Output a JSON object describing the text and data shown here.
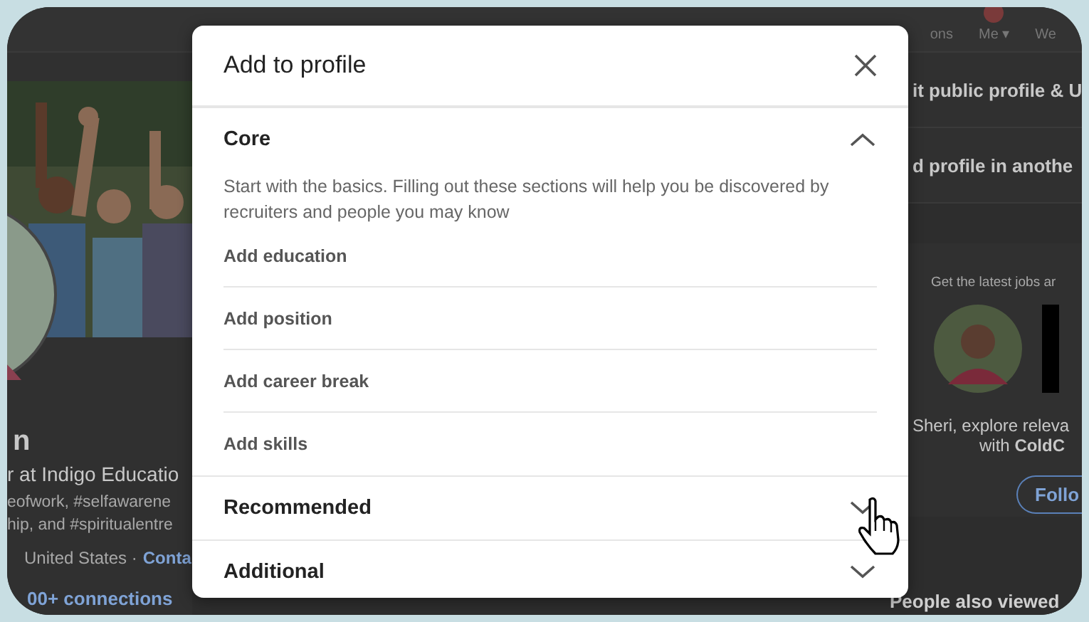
{
  "nav_items": [
    {
      "label": "ons"
    },
    {
      "label": "Me ▾"
    },
    {
      "label": "We"
    }
  ],
  "profile": {
    "name": "n",
    "headline": "r at Indigo Educatio",
    "hashtags": [
      "eofwork, #selfawarene",
      "hip, and #spiritualentre"
    ],
    "location": "United States ·",
    "contact_link": "Conta",
    "connections": "00+ connections"
  },
  "sidebar": {
    "links": [
      "it public profile & U",
      "d profile in anothe"
    ],
    "ad": {
      "tagline": "Get the latest jobs ar",
      "message": "Sheri, explore releva",
      "message_line2": "with **ColdC**",
      "follow_button": "Follo"
    },
    "people_also_viewed": "People also viewed"
  },
  "dialog": {
    "title": "Add to profile",
    "sections": [
      {
        "title": "Core",
        "expanded": true,
        "description": "Start with the basics. Filling out these sections will help you be discovered by recruiters and people you may know",
        "items": [
          "Add education",
          "Add position",
          "Add career break",
          "Add skills"
        ]
      },
      {
        "title": "Recommended",
        "expanded": false
      },
      {
        "title": "Additional",
        "expanded": false
      }
    ]
  }
}
